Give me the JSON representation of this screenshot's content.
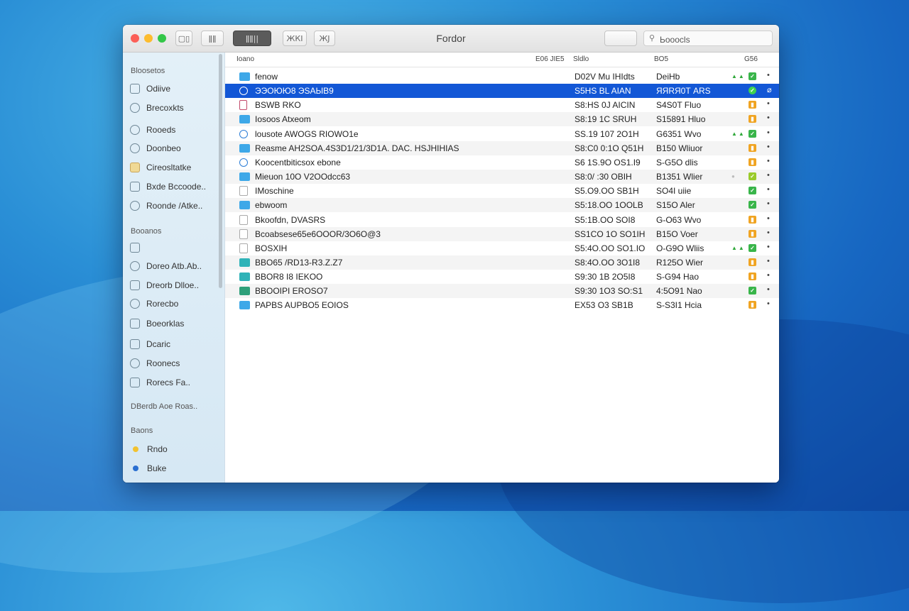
{
  "window": {
    "title": "Fordor"
  },
  "toolbar": {
    "view_buttons": [
      "▢▯",
      "ǁǁ",
      "ǁǁ||",
      "ЖКI",
      "ЖJ"
    ],
    "blank_button": "",
    "search_value": "Ьоoocls"
  },
  "sidebar": {
    "sections": [
      {
        "heading": "Bloosetos",
        "items": [
          {
            "label": "Odiive",
            "icon": "drive-icon"
          },
          {
            "label": "Brecoxkts",
            "icon": "cloud-icon"
          },
          {
            "label": "Rooeds",
            "icon": "user-icon"
          },
          {
            "label": "Doonbeo",
            "icon": "download-icon"
          },
          {
            "label": "Cireosltatke",
            "icon": "folder-icon"
          },
          {
            "label": "Bxde Bccoode..",
            "icon": "document-icon"
          },
          {
            "label": "Roonde /Atke..",
            "icon": "clock-icon"
          }
        ]
      },
      {
        "heading": "Booanos",
        "items": [
          {
            "label": "",
            "icon": "disk-icon"
          },
          {
            "label": "Doreo Atb.Ab..",
            "icon": "user-icon"
          },
          {
            "label": "Dreorb Dlloe..",
            "icon": "document-icon"
          },
          {
            "label": "Rorecbo",
            "icon": "user-icon"
          },
          {
            "label": "Boeorklas",
            "icon": "drive-icon"
          },
          {
            "label": "Dcaric",
            "icon": "disk-icon"
          },
          {
            "label": "Roonecs",
            "icon": "user-icon"
          },
          {
            "label": "Rorecs Fa..",
            "icon": "drive-icon"
          }
        ]
      },
      {
        "heading": "DBerdb Aoe Roas..",
        "items": []
      },
      {
        "heading": "Baons",
        "items": [
          {
            "label": "Rndo",
            "tag_color": "#f2c230"
          },
          {
            "label": "Buke",
            "tag_color": "#2a6fd1"
          }
        ]
      }
    ]
  },
  "columns": {
    "name": "Ioano",
    "extra": "E06 JIE5",
    "date": "Sldlo",
    "size": "BO5",
    "kind": "G56"
  },
  "files": [
    {
      "name": "fenow",
      "date": "D02V Mu IHIdts",
      "size": "DeiHb",
      "icon": "folder-blue",
      "badge": "green",
      "arrows": true
    },
    {
      "name": "ЭЭОЮЮ8 ЭSAЫB9",
      "date": "S5HS BL AIAN",
      "size": "ЯЯRЯ0Т ARS",
      "icon": "app",
      "badge": "green",
      "selected": true
    },
    {
      "name": "BSWB RKO",
      "date": "S8:HS 0J AICIN",
      "size": "S4S0T Fluo",
      "icon": "doc-red",
      "badge": "orange"
    },
    {
      "name": "Iosoos Atxeom",
      "date": "S8:19 1C SRUH",
      "size": "S15891 Hluo",
      "icon": "folder-blue",
      "badge": "orange"
    },
    {
      "name": "lousote AWOGS RIOWO1e",
      "date": "SS.19 107 2O1H",
      "size": "G6351 Wvo",
      "icon": "app",
      "badge": "green",
      "arrows": true
    },
    {
      "name": "Reasme AH2SOA.4S3D1/21/3D1A. DAC. HSJHIHIAS",
      "date": "S8:C0 0:1O Q51H",
      "size": "B150 Wliuor",
      "icon": "folder-blue",
      "badge": "orange"
    },
    {
      "name": "Koocentbiticsox ebone",
      "date": "S6 1S.9O OS1.I9",
      "size": "S-G5O dlis",
      "icon": "app",
      "badge": "orange"
    },
    {
      "name": "Mieuon 10O V2OOdcc63",
      "date": "S8:0/ :30 OBIH",
      "size": "B1351 Wlier",
      "icon": "folder-blue",
      "badge": "ygreen",
      "dot": true
    },
    {
      "name": "IMoschine",
      "date": "S5.O9.OO SB1H",
      "size": "SO4I uiie",
      "icon": "doc",
      "badge": "green"
    },
    {
      "name": "ebwoom",
      "date": "S5:18.OO 1OOLB",
      "size": "S15O Aler",
      "icon": "folder-blue",
      "badge": "green"
    },
    {
      "name": "Bkoofdn, DVASRS",
      "date": "S5:1B.OO SOI8",
      "size": "G-O63 Wvo",
      "icon": "doc",
      "badge": "orange"
    },
    {
      "name": "Bcoabsese65e6OOOR/3O6O@3",
      "date": "SS1CO 1O SO1IH",
      "size": "B15O Voer",
      "icon": "doc",
      "badge": "orange"
    },
    {
      "name": "BOSXIH",
      "date": "S5:4O.OO SO1.IO",
      "size": "O-G9O Wliis",
      "icon": "doc",
      "badge": "green",
      "arrows": true
    },
    {
      "name": "BBO65 /RD13-R3.Z.Z7",
      "date": "S8:4O.OO 3O1I8",
      "size": "R125O Wier",
      "icon": "folder-teal",
      "badge": "orange"
    },
    {
      "name": "BBOR8 I8 IEKOO",
      "date": "S9:30 1B 2O5I8",
      "size": "S-G94 Hao",
      "icon": "folder-teal",
      "badge": "orange"
    },
    {
      "name": "BBOOIPI EROSO7",
      "date": "S9:30 1O3 SO:S1",
      "size": "4:5O91 Nao",
      "icon": "folder-green",
      "badge": "green"
    },
    {
      "name": "PAPBS AUPBO5 EOIOS",
      "date": "EX53 O3 SB1B",
      "size": "S-S3I1 Hcia",
      "icon": "folder-blue",
      "badge": "orange"
    }
  ]
}
